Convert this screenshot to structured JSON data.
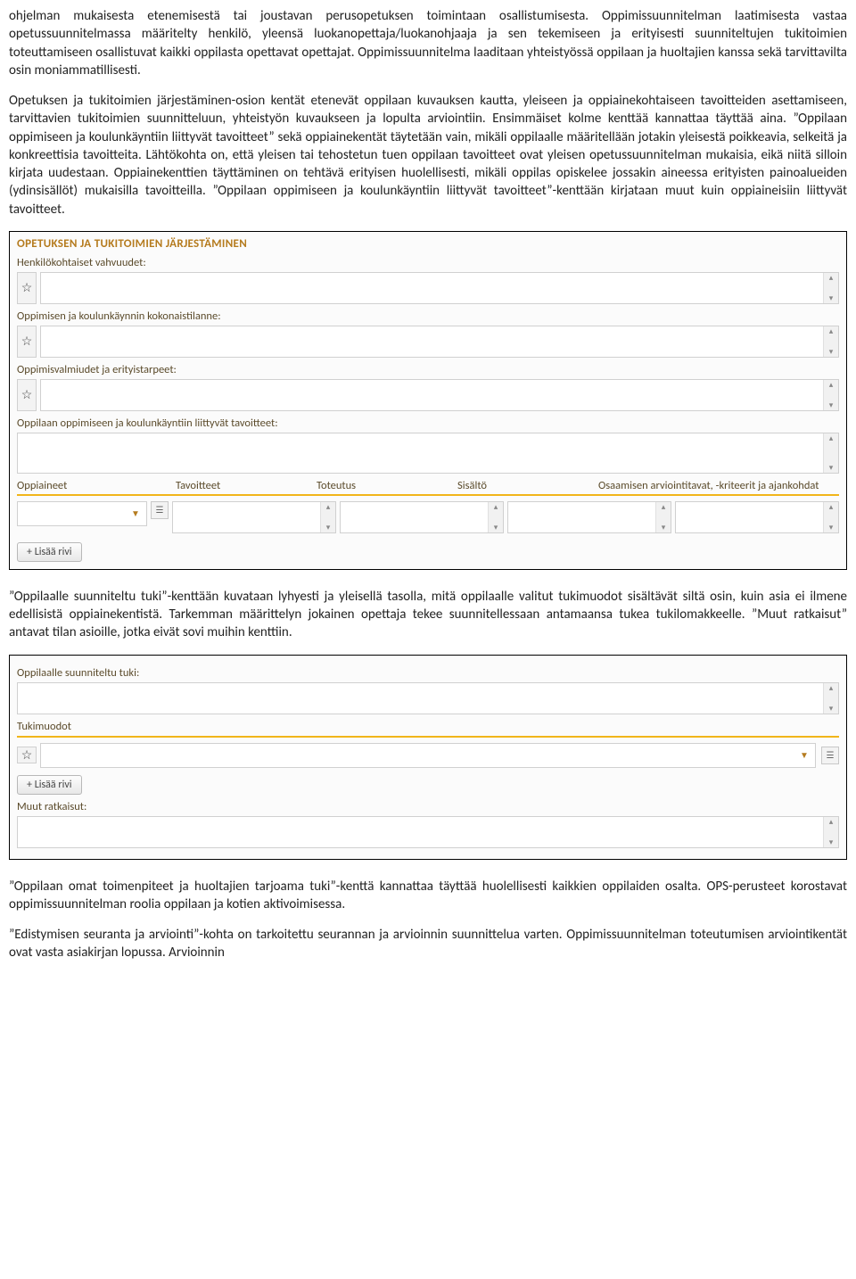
{
  "paragraphs": {
    "p1": "ohjelman mukaisesta etenemisestä tai joustavan perusopetuksen toimintaan osallistumisesta. Oppimissuunnitelman laatimisesta vastaa opetussuunnitelmassa määritelty henkilö, yleensä luokanopettaja/luokanohjaaja ja sen tekemiseen ja erityisesti suunniteltujen tukitoimien toteuttamiseen osallistuvat kaikki oppilasta opettavat opettajat. Oppimissuunnitelma laaditaan yhteistyössä oppilaan ja huoltajien kanssa sekä tarvittavilta osin moniammatillisesti.",
    "p2": "Opetuksen ja tukitoimien järjestäminen-osion kentät etenevät oppilaan kuvauksen kautta, yleiseen ja oppiainekohtaiseen tavoitteiden asettamiseen, tarvittavien tukitoimien suunnitteluun, yhteistyön kuvaukseen ja lopulta arviointiin. Ensimmäiset kolme kenttää kannattaa täyttää aina. ”Oppilaan oppimiseen ja koulunkäyntiin liittyvät tavoitteet” sekä oppiainekentät täytetään vain, mikäli oppilaalle määritellään jotakin yleisestä poikkeavia, selkeitä ja konkreettisia tavoitteita. Lähtökohta on, että yleisen tai tehostetun tuen oppilaan tavoitteet ovat yleisen opetussuunnitelman mukaisia, eikä niitä silloin kirjata uudestaan. Oppiainekenttien täyttäminen on tehtävä erityisen huolellisesti, mikäli oppilas opiskelee jossakin aineessa erityisten painoalueiden (ydinsisällöt) mukaisilla tavoitteilla. ”Oppilaan oppimiseen ja koulunkäyntiin liittyvät tavoitteet”-kenttään kirjataan muut kuin oppiaineisiin liittyvät tavoitteet.",
    "p3": "”Oppilaalle suunniteltu tuki”-kenttään kuvataan lyhyesti ja yleisellä tasolla, mitä oppilaalle valitut tukimuodot sisältävät siltä osin, kuin asia ei ilmene edellisistä oppiainekentistä. Tarkemman määrittelyn jokainen opettaja tekee suunnitellessaan antamaansa tukea tukilomakkeelle. ”Muut ratkaisut” antavat tilan asioille, jotka eivät sovi muihin kenttiin.",
    "p4": "”Oppilaan omat toimenpiteet ja huoltajien tarjoama tuki”-kenttä kannattaa täyttää huolellisesti kaikkien oppilaiden osalta. OPS-perusteet korostavat oppimissuunnitelman roolia oppilaan ja kotien aktivoimisessa.",
    "p5": "”Edistymisen seuranta ja arviointi”-kohta on tarkoitettu seurannan ja arvioinnin suunnittelua varten. Oppimissuunnitelman toteutumisen arviointikentät ovat vasta asiakirjan lopussa. Arvioinnin"
  },
  "form1": {
    "heading": "OPETUKSEN JA TUKITOIMIEN JÄRJESTÄMINEN",
    "labels": {
      "f1": "Henkilökohtaiset vahvuudet:",
      "f2": "Oppimisen ja koulunkäynnin kokonaistilanne:",
      "f3": "Oppimisvalmiudet ja erityistarpeet:",
      "f4": "Oppilaan oppimiseen ja koulunkäyntiin liittyvät tavoitteet:"
    },
    "columns": {
      "c1": "Oppiaineet",
      "c2": "Tavoitteet",
      "c3": "Toteutus",
      "c4": "Sisältö",
      "c5": "Osaamisen arviointitavat, -kriteerit ja ajankohdat"
    },
    "add_row": "+ Lisää rivi"
  },
  "form2": {
    "labels": {
      "f1": "Oppilaalle suunniteltu tuki:",
      "f2": "Tukimuodot",
      "f3": "Muut ratkaisut:"
    },
    "add_row": "+ Lisää rivi"
  },
  "icons": {
    "star": "☆",
    "up": "▴",
    "down": "▾",
    "dd": "▼",
    "list": "☰"
  }
}
